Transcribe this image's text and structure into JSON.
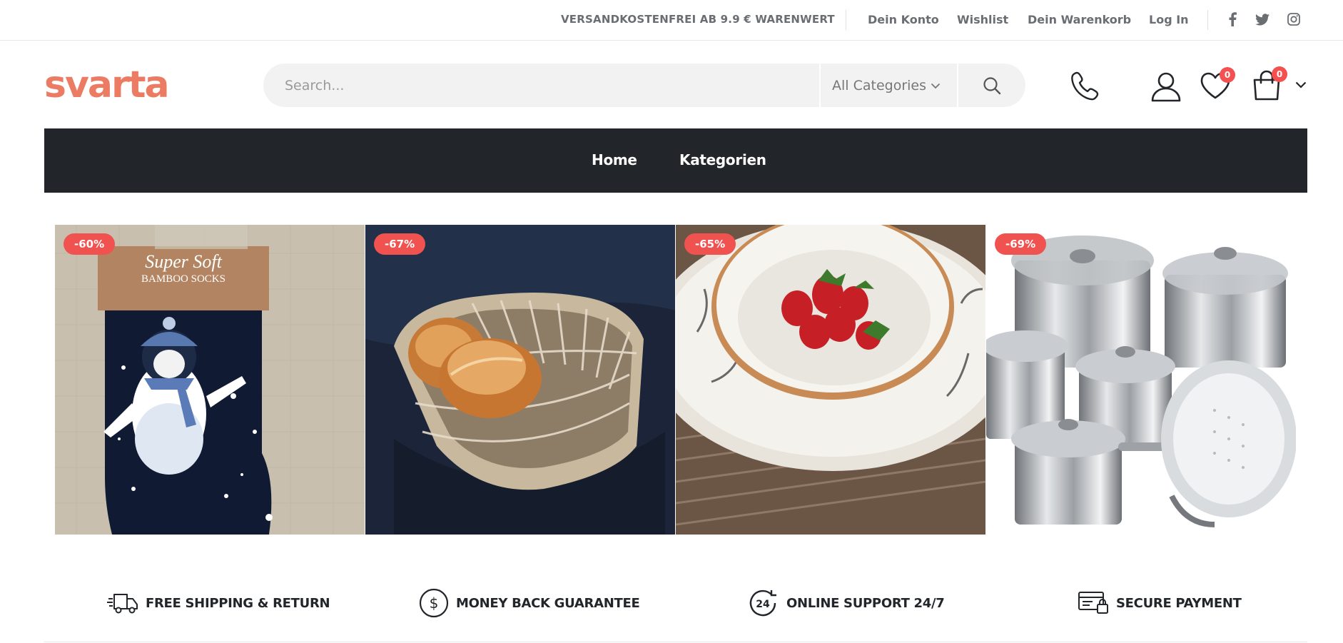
{
  "topbar": {
    "notice": "VERSANDKOSTENFREI AB 9.9 € WARENWERT",
    "links": [
      "Dein Konto",
      "Wishlist",
      "Dein Warenkorb",
      "Log In"
    ],
    "social": [
      "facebook-icon",
      "twitter-icon",
      "instagram-icon"
    ]
  },
  "header": {
    "logo": "svarta",
    "search_placeholder": "Search...",
    "category_select": "All Categories",
    "wishlist_count": "0",
    "cart_count": "0"
  },
  "nav": {
    "items": [
      "Home",
      "Kategorien"
    ]
  },
  "products": [
    {
      "discount": "-60%",
      "image": "penguin bamboo socks"
    },
    {
      "discount": "-67%",
      "image": "heart-shaped wicker bread basket"
    },
    {
      "discount": "-65%",
      "image": "ceramic bowl with strawberries"
    },
    {
      "discount": "-69%",
      "image": "stainless steel cookware set"
    }
  ],
  "features": [
    {
      "label": "FREE SHIPPING & RETURN",
      "icon": "truck-icon"
    },
    {
      "label": "MONEY BACK GUARANTEE",
      "icon": "dollar-circle-icon"
    },
    {
      "label": "ONLINE SUPPORT 24/7",
      "icon": "support-24-icon"
    },
    {
      "label": "SECURE PAYMENT",
      "icon": "secure-payment-icon"
    }
  ],
  "colors": {
    "brand": "#ec7b63",
    "nav_bg": "#222529",
    "badge": "#f0524f"
  }
}
